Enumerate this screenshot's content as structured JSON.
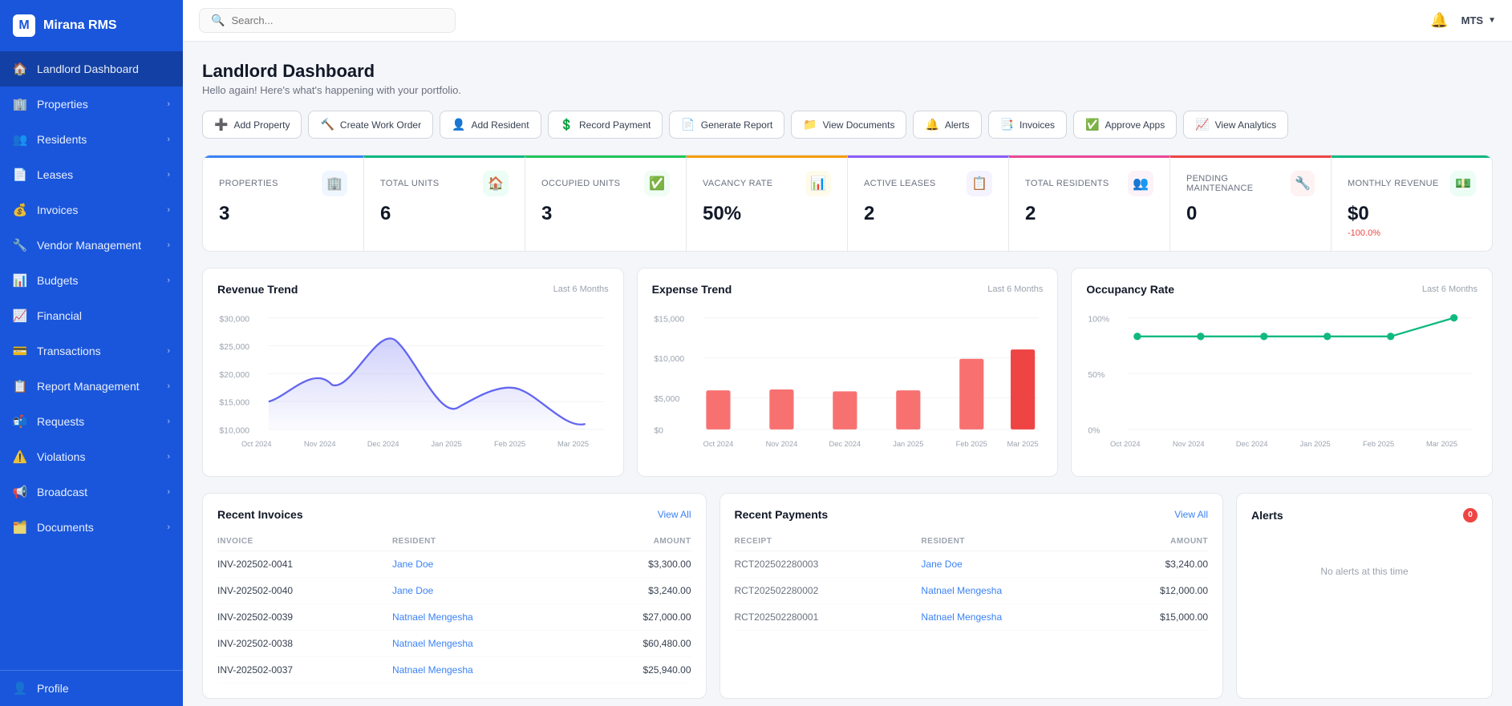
{
  "app": {
    "name": "Mirana RMS",
    "user": "MTS"
  },
  "search": {
    "placeholder": "Search..."
  },
  "sidebar": {
    "items": [
      {
        "id": "dashboard",
        "label": "Landlord Dashboard",
        "icon": "🏠",
        "active": true,
        "hasChevron": false
      },
      {
        "id": "properties",
        "label": "Properties",
        "icon": "🏢",
        "active": false,
        "hasChevron": true
      },
      {
        "id": "residents",
        "label": "Residents",
        "icon": "👥",
        "active": false,
        "hasChevron": true
      },
      {
        "id": "leases",
        "label": "Leases",
        "icon": "📄",
        "active": false,
        "hasChevron": true
      },
      {
        "id": "invoices",
        "label": "Invoices",
        "icon": "💰",
        "active": false,
        "hasChevron": true
      },
      {
        "id": "vendor",
        "label": "Vendor Management",
        "icon": "🔧",
        "active": false,
        "hasChevron": true
      },
      {
        "id": "budgets",
        "label": "Budgets",
        "icon": "📊",
        "active": false,
        "hasChevron": true
      },
      {
        "id": "financial",
        "label": "Financial",
        "icon": "📈",
        "active": false,
        "hasChevron": false
      },
      {
        "id": "transactions",
        "label": "Transactions",
        "icon": "💳",
        "active": false,
        "hasChevron": true
      },
      {
        "id": "report",
        "label": "Report Management",
        "icon": "📋",
        "active": false,
        "hasChevron": true
      },
      {
        "id": "requests",
        "label": "Requests",
        "icon": "📬",
        "active": false,
        "hasChevron": true
      },
      {
        "id": "violations",
        "label": "Violations",
        "icon": "⚠️",
        "active": false,
        "hasChevron": true
      },
      {
        "id": "broadcast",
        "label": "Broadcast",
        "icon": "📢",
        "active": false,
        "hasChevron": true
      },
      {
        "id": "documents",
        "label": "Documents",
        "icon": "🗂️",
        "active": false,
        "hasChevron": true
      }
    ],
    "profile": {
      "label": "Profile",
      "icon": "👤"
    }
  },
  "page": {
    "title": "Landlord Dashboard",
    "subtitle": "Hello again! Here's what's happening with your portfolio."
  },
  "actions": [
    {
      "id": "add-property",
      "label": "Add Property",
      "icon": "➕"
    },
    {
      "id": "create-work-order",
      "label": "Create Work Order",
      "icon": "🔨"
    },
    {
      "id": "add-resident",
      "label": "Add Resident",
      "icon": "👤"
    },
    {
      "id": "record-payment",
      "label": "Record Payment",
      "icon": "💲"
    },
    {
      "id": "generate-report",
      "label": "Generate Report",
      "icon": "📄"
    },
    {
      "id": "view-documents",
      "label": "View Documents",
      "icon": "📁"
    },
    {
      "id": "alerts",
      "label": "Alerts",
      "icon": "🔔"
    },
    {
      "id": "invoices",
      "label": "Invoices",
      "icon": "📑"
    },
    {
      "id": "approve-apps",
      "label": "Approve Apps",
      "icon": "✅"
    },
    {
      "id": "view-analytics",
      "label": "View Analytics",
      "icon": "📈"
    }
  ],
  "stats": [
    {
      "id": "properties",
      "label": "Properties",
      "value": "3",
      "icon": "🏢",
      "iconBg": "#eff6ff",
      "topColor": "blue-top",
      "change": null
    },
    {
      "id": "total-units",
      "label": "Total Units",
      "value": "6",
      "icon": "🏠",
      "iconBg": "#ecfdf5",
      "topColor": "green-top",
      "change": null
    },
    {
      "id": "occupied-units",
      "label": "Occupied Units",
      "value": "3",
      "icon": "✅",
      "iconBg": "#f0fdf4",
      "topColor": "green2-top",
      "change": null
    },
    {
      "id": "vacancy-rate",
      "label": "Vacancy Rate",
      "value": "50%",
      "icon": "📊",
      "iconBg": "#fffbeb",
      "topColor": "orange-top",
      "change": null
    },
    {
      "id": "active-leases",
      "label": "Active Leases",
      "value": "2",
      "icon": "📋",
      "iconBg": "#f5f3ff",
      "topColor": "purple-top",
      "change": null
    },
    {
      "id": "total-residents",
      "label": "Total Residents",
      "value": "2",
      "icon": "👥",
      "iconBg": "#fdf2f8",
      "topColor": "pink-top",
      "change": null
    },
    {
      "id": "pending-maintenance",
      "label": "Pending Maintenance",
      "value": "0",
      "icon": "🔧",
      "iconBg": "#fef2f2",
      "topColor": "red-top",
      "change": null
    },
    {
      "id": "monthly-revenue",
      "label": "Monthly Revenue",
      "value": "$0",
      "icon": "💵",
      "iconBg": "#ecfdf5",
      "topColor": "emerald-top",
      "change": "-100.0%"
    }
  ],
  "revenue_chart": {
    "title": "Revenue Trend",
    "period": "Last 6 Months",
    "labels": [
      "Oct 2024",
      "Nov 2024",
      "Dec 2024",
      "Jan 2025",
      "Feb 2025",
      "Mar 2025"
    ],
    "values": [
      15000,
      18000,
      26000,
      14000,
      17000,
      11000
    ],
    "yLabels": [
      "$10,000",
      "$15,000",
      "$20,000",
      "$25,000",
      "$30,000"
    ]
  },
  "expense_chart": {
    "title": "Expense Trend",
    "period": "Last 6 Months",
    "labels": [
      "Oct 2024",
      "Nov 2024",
      "Dec 2024",
      "Jan 2025",
      "Feb 2025",
      "Mar 2025"
    ],
    "values": [
      5200,
      5400,
      5100,
      5300,
      9500,
      10800
    ],
    "yLabels": [
      "$0",
      "$5,000",
      "$10,000",
      "$15,000"
    ]
  },
  "occupancy_chart": {
    "title": "Occupancy Rate",
    "period": "Last 6 Months",
    "labels": [
      "Oct 2024",
      "Nov 2024",
      "Dec 2024",
      "Jan 2025",
      "Feb 2025",
      "Mar 2025"
    ],
    "values": [
      83,
      83,
      83,
      83,
      83,
      100
    ],
    "yLabels": [
      "0%",
      "50%",
      "100%"
    ]
  },
  "invoices": {
    "title": "Recent Invoices",
    "view_all": "View All",
    "columns": [
      "INVOICE",
      "RESIDENT",
      "AMOUNT"
    ],
    "rows": [
      {
        "invoice": "INV-202502-0041",
        "resident": "Jane Doe",
        "amount": "$3,300.00"
      },
      {
        "invoice": "INV-202502-0040",
        "resident": "Jane Doe",
        "amount": "$3,240.00"
      },
      {
        "invoice": "INV-202502-0039",
        "resident": "Natnael Mengesha",
        "amount": "$27,000.00"
      },
      {
        "invoice": "INV-202502-0038",
        "resident": "Natnael Mengesha",
        "amount": "$60,480.00"
      },
      {
        "invoice": "INV-202502-0037",
        "resident": "Natnael Mengesha",
        "amount": "$25,940.00"
      }
    ]
  },
  "payments": {
    "title": "Recent Payments",
    "view_all": "View All",
    "columns": [
      "RECEIPT",
      "RESIDENT",
      "AMOUNT"
    ],
    "rows": [
      {
        "receipt": "RCT202502280003",
        "resident": "Jane Doe",
        "amount": "$3,240.00"
      },
      {
        "receipt": "RCT202502280002",
        "resident": "Natnael Mengesha",
        "amount": "$12,000.00"
      },
      {
        "receipt": "RCT202502280001",
        "resident": "Natnael Mengesha",
        "amount": "$15,000.00"
      }
    ]
  },
  "alerts": {
    "title": "Alerts",
    "badge": "0",
    "empty_message": "No alerts at this time"
  }
}
